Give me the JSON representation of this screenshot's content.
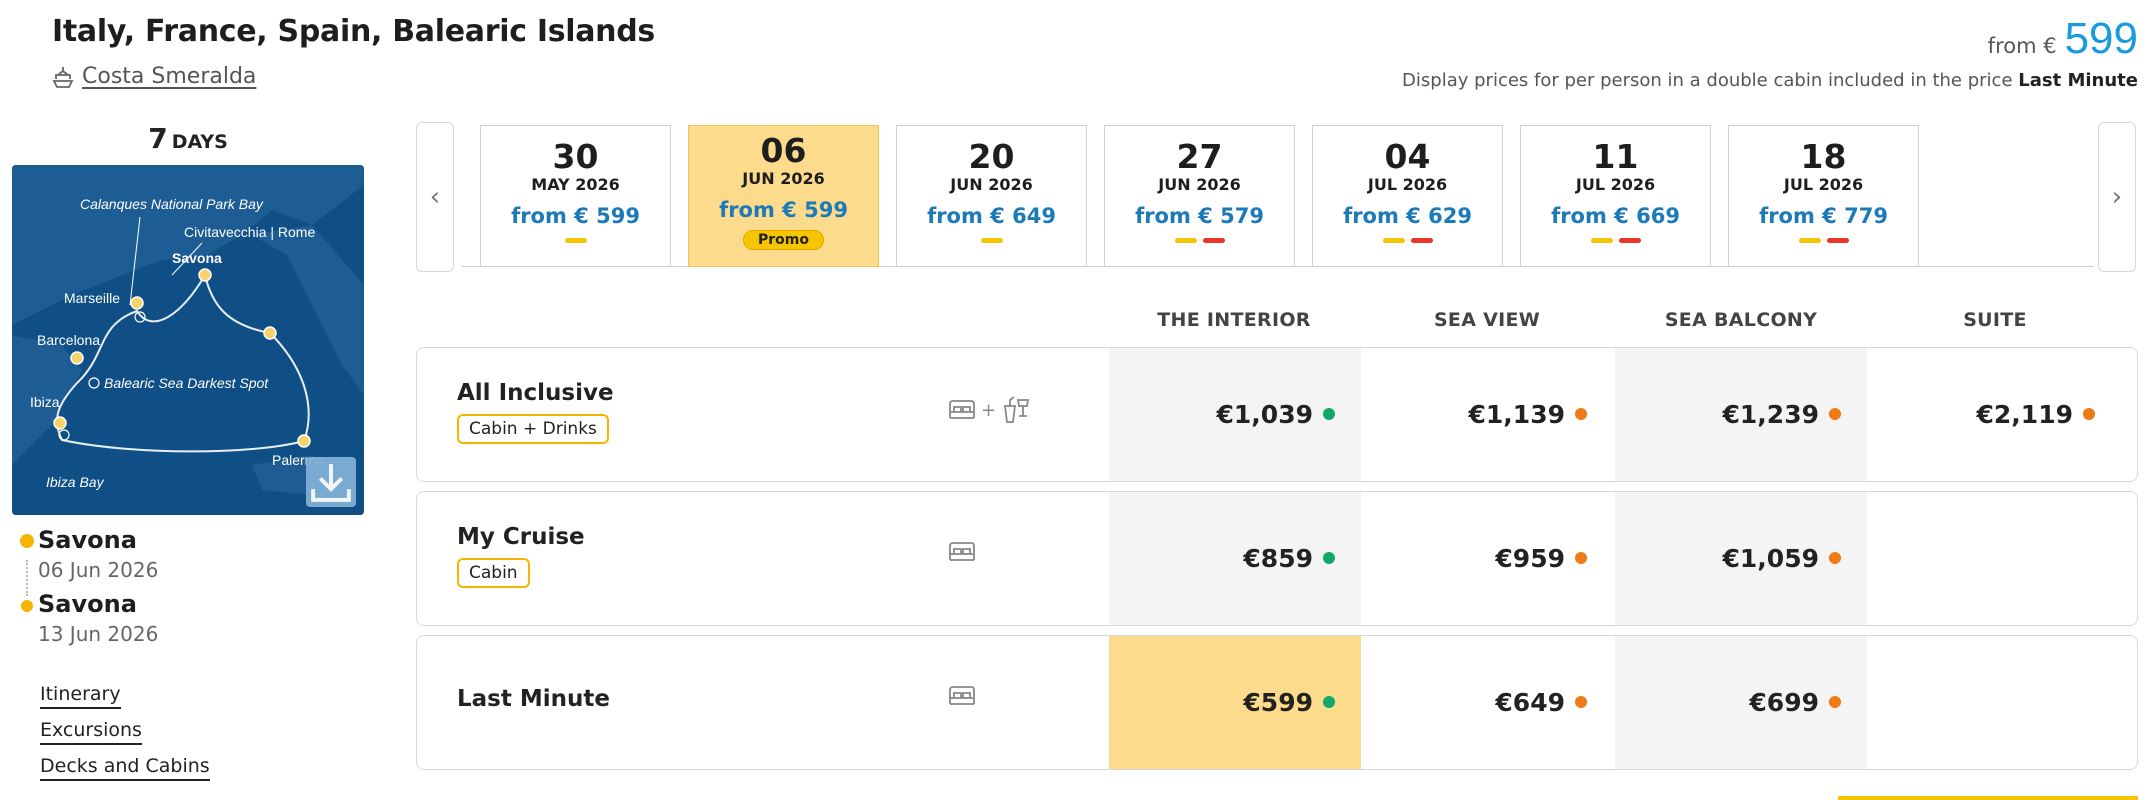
{
  "header": {
    "title": "Italy, France, Spain, Balearic Islands",
    "ship": "Costa Smeralda",
    "from_label": "from €",
    "from_price": "599",
    "note_text": "Display prices for per person in a double cabin included in the price",
    "note_bold": "Last Minute"
  },
  "trip": {
    "days_number": "7",
    "days_label": "DAYS",
    "map_labels": {
      "calanques": "Calanques National Park Bay",
      "civitavecchia": "Civitavecchia | Rome",
      "savona": "Savona",
      "marseille": "Marseille",
      "barcelona": "Barcelona",
      "balearic": "Balearic Sea Darkest Spot",
      "ibiza": "Ibiza",
      "palermo": "Palermo",
      "ibiza_bay": "Ibiza Bay"
    },
    "departure": {
      "city": "Savona",
      "date": "06 Jun 2026"
    },
    "arrival": {
      "city": "Savona",
      "date": "13 Jun 2026"
    }
  },
  "links": [
    "Itinerary",
    "Excursions",
    "Decks and Cabins"
  ],
  "dates": [
    {
      "day": "30",
      "month": "MAY 2026",
      "from": "from € 599",
      "bars": [
        "yellow"
      ]
    },
    {
      "day": "06",
      "month": "JUN 2026",
      "from": "from € 599",
      "promo": "Promo",
      "selected": true
    },
    {
      "day": "20",
      "month": "JUN 2026",
      "from": "from € 649",
      "bars": [
        "yellow"
      ]
    },
    {
      "day": "27",
      "month": "JUN 2026",
      "from": "from € 579",
      "bars": [
        "yellow",
        "red"
      ]
    },
    {
      "day": "04",
      "month": "JUL 2026",
      "from": "from € 629",
      "bars": [
        "yellow",
        "red"
      ]
    },
    {
      "day": "11",
      "month": "JUL 2026",
      "from": "from € 669",
      "bars": [
        "yellow",
        "red"
      ]
    },
    {
      "day": "18",
      "month": "JUL 2026",
      "from": "from € 779",
      "bars": [
        "yellow",
        "red"
      ]
    }
  ],
  "cabin_types": [
    "THE INTERIOR",
    "SEA VIEW",
    "SEA BALCONY",
    "SUITE"
  ],
  "fares": [
    {
      "name": "All Inclusive",
      "tag": "Cabin + Drinks",
      "icons": "bed+drinks",
      "prices": [
        {
          "v": "€1,039",
          "s": "green"
        },
        {
          "v": "€1,139",
          "s": "orange"
        },
        {
          "v": "€1,239",
          "s": "orange"
        },
        {
          "v": "€2,119",
          "s": "orange"
        }
      ]
    },
    {
      "name": "My Cruise",
      "tag": "Cabin",
      "icons": "bed",
      "prices": [
        {
          "v": "€859",
          "s": "green"
        },
        {
          "v": "€959",
          "s": "orange"
        },
        {
          "v": "€1,059",
          "s": "orange"
        }
      ]
    },
    {
      "name": "Last Minute",
      "tag": "",
      "icons": "bed",
      "highlight": 0,
      "prices": [
        {
          "v": "€599",
          "s": "green"
        },
        {
          "v": "€649",
          "s": "orange"
        },
        {
          "v": "€699",
          "s": "orange"
        }
      ]
    }
  ],
  "colors": {
    "accent": "#1a9be0",
    "selected": "#fcdb8c",
    "yellow": "#f5c500",
    "red": "#e8362b",
    "green": "#12a86b",
    "orange": "#f07a14"
  }
}
